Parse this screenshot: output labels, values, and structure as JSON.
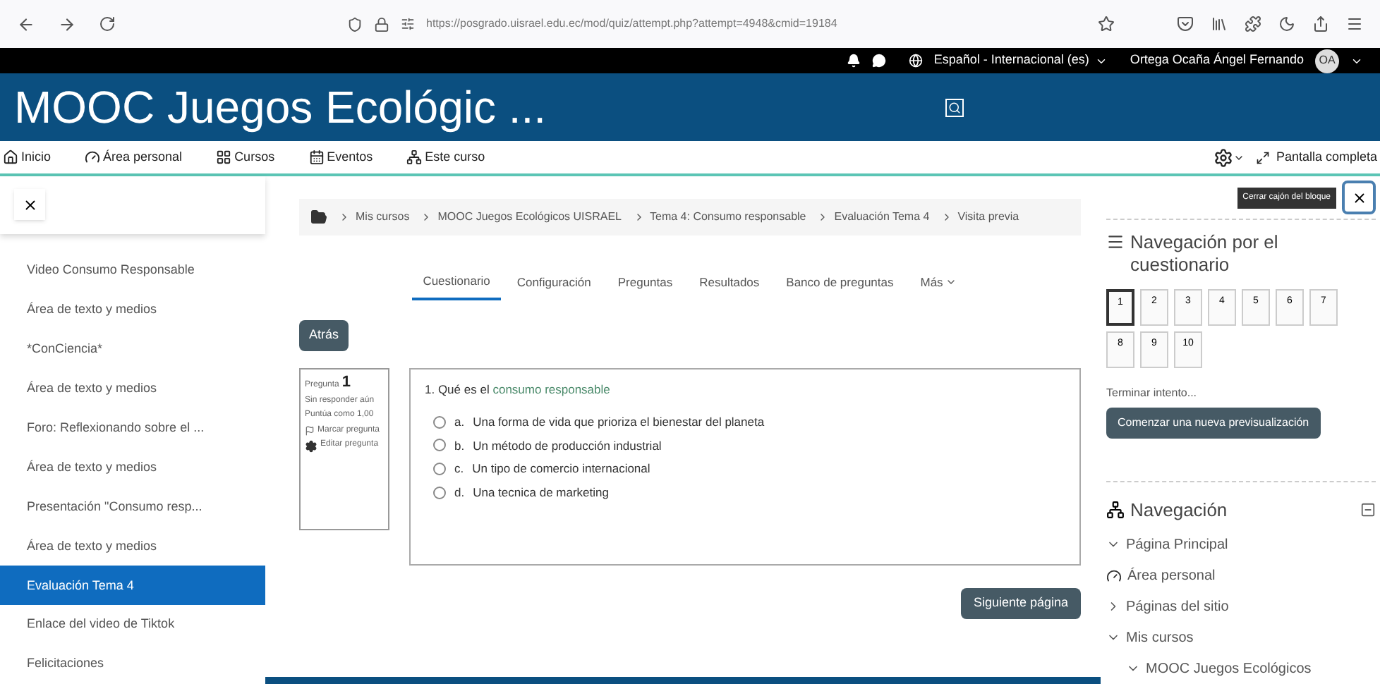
{
  "browser": {
    "url": "https://posgrado.uisrael.edu.ec/mod/quiz/attempt.php?attempt=4948&cmid=19184"
  },
  "topbar": {
    "language": "Español - Internacional (es)",
    "user_name": "Ortega Ocaña Ángel Fernando",
    "avatar_initials": "OA"
  },
  "header": {
    "title": "MOOC Juegos Ecológic ..."
  },
  "nav": {
    "items": [
      {
        "label": "Inicio",
        "kind": "home"
      },
      {
        "label": "Área personal",
        "kind": "dashboard"
      },
      {
        "label": "Cursos",
        "kind": "grid"
      },
      {
        "label": "Eventos",
        "kind": "calendar"
      },
      {
        "label": "Este curso",
        "kind": "sitemap"
      }
    ],
    "fullscreen": "Pantalla completa"
  },
  "sidebar": {
    "items": [
      {
        "label": "Video Consumo Responsable",
        "selected": false
      },
      {
        "label": "Área de texto y medios",
        "selected": false
      },
      {
        "label": "*ConCiencia*",
        "selected": false
      },
      {
        "label": "Área de texto y medios",
        "selected": false
      },
      {
        "label": "Foro: Reflexionando sobre el ...",
        "selected": false
      },
      {
        "label": "Área de texto y medios",
        "selected": false
      },
      {
        "label": "Presentación \"Consumo resp...",
        "selected": false
      },
      {
        "label": "Área de texto y medios",
        "selected": false
      },
      {
        "label": "Evaluación Tema 4",
        "selected": true
      },
      {
        "label": "Enlace del video de Tiktok",
        "selected": false
      },
      {
        "label": "Felicitaciones",
        "selected": false
      }
    ]
  },
  "breadcrumb": [
    "Mis cursos",
    "MOOC Juegos Ecológicos UISRAEL",
    "Tema 4: Consumo responsable",
    "Evaluación Tema 4",
    "Visita previa"
  ],
  "tabs": [
    {
      "label": "Cuestionario",
      "selected": true
    },
    {
      "label": "Configuración",
      "selected": false
    },
    {
      "label": "Preguntas",
      "selected": false
    },
    {
      "label": "Resultados",
      "selected": false
    },
    {
      "label": "Banco de preguntas",
      "selected": false
    },
    {
      "label": "Más",
      "selected": false
    }
  ],
  "back_button": "Atrás",
  "question_info": {
    "label": "Pregunta",
    "number": "1",
    "status": "Sin responder aún",
    "points": "Puntúa como 1,00",
    "flag": "Marcar pregunta",
    "edit": "Editar pregunta"
  },
  "question": {
    "prompt": "1. Qué es el",
    "term": "consumo responsable",
    "options": [
      {
        "letter": "a.",
        "text": "Una forma de vida que prioriza el bienestar del planeta",
        "selected": false
      },
      {
        "letter": "b.",
        "text": "Un método de producción industrial",
        "selected": false
      },
      {
        "letter": "c.",
        "text": "Un tipo de comercio internacional",
        "selected": false
      },
      {
        "letter": "d.",
        "text": "Una tecnica de marketing",
        "selected": false
      }
    ]
  },
  "next_button": "Siguiente página",
  "tooltip": "Cerrar cajón del bloque",
  "quiz_nav": {
    "title": "Navegación por el cuestionario",
    "buttons": [
      {
        "label": "1",
        "selected": true
      },
      {
        "label": "2",
        "selected": false
      },
      {
        "label": "3",
        "selected": false
      },
      {
        "label": "4",
        "selected": false
      },
      {
        "label": "5",
        "selected": false
      },
      {
        "label": "6",
        "selected": false
      },
      {
        "label": "7",
        "selected": false
      },
      {
        "label": "8",
        "selected": false
      },
      {
        "label": "9",
        "selected": false
      },
      {
        "label": "10",
        "selected": false
      }
    ],
    "finish_link": "Terminar intento...",
    "restart_button": "Comenzar una nueva previsualización"
  },
  "navigation": {
    "title": "Navegación",
    "tree": [
      {
        "label": "Página Principal",
        "kind": "branch",
        "expanded": true
      },
      {
        "label": "Área personal",
        "kind": "dashboard"
      },
      {
        "label": "Páginas del sitio",
        "kind": "branch",
        "expanded": false
      },
      {
        "label": "Mis cursos",
        "kind": "branch",
        "expanded": true,
        "children": [
          {
            "label": "MOOC Juegos Ecológicos",
            "kind": "branch",
            "expanded": true
          }
        ]
      }
    ]
  }
}
